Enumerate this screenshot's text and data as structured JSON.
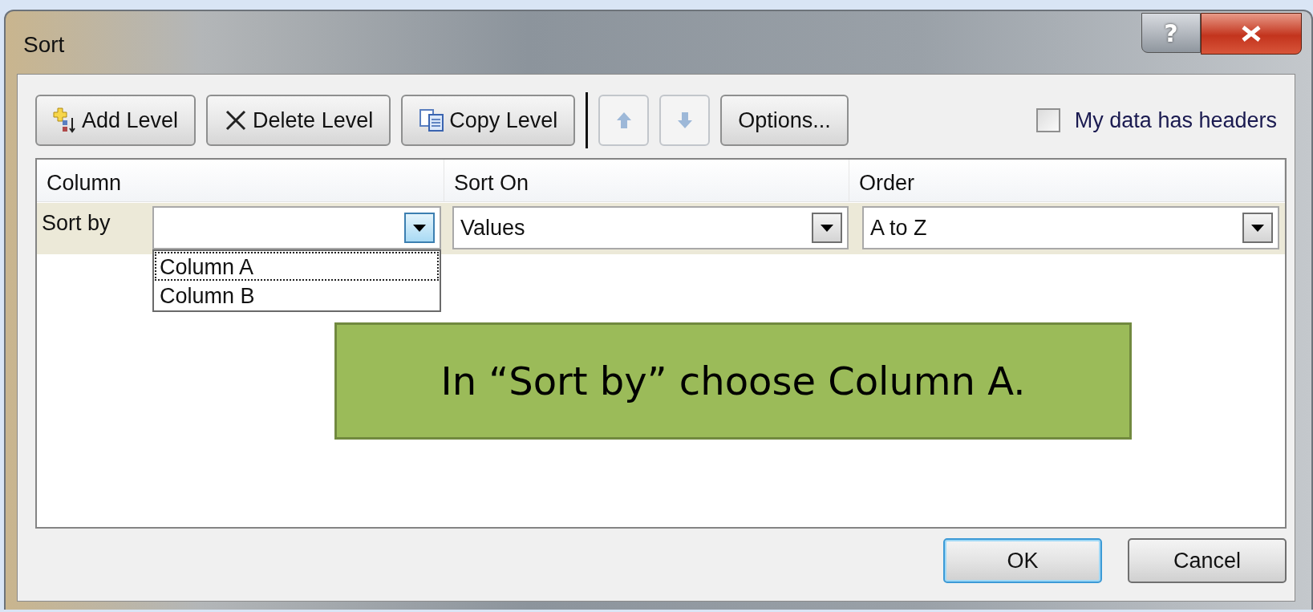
{
  "window": {
    "title": "Sort",
    "help_button": {
      "label": "?"
    }
  },
  "toolbar": {
    "buttons": [
      {
        "kind": "add",
        "label": "Add Level",
        "disabled": false
      },
      {
        "kind": "delete",
        "label": "Delete Level",
        "disabled": false
      },
      {
        "kind": "copy",
        "label": "Copy Level",
        "disabled": false
      },
      {
        "kind": "up",
        "disabled": true
      },
      {
        "kind": "down",
        "disabled": true
      },
      {
        "kind": "plain",
        "label": "Options...",
        "disabled": false
      }
    ],
    "checkbox": {
      "label": "My data has headers",
      "checked": false
    }
  },
  "grid": {
    "columns": [
      "Column",
      "Sort On",
      "Order"
    ],
    "row": {
      "label": "Sort by",
      "column": {
        "open": true,
        "options": [
          {
            "label": "Column A",
            "selected": true
          },
          {
            "label": "Column B",
            "selected": false
          }
        ]
      },
      "sort_on": {
        "value": "Values",
        "open": false
      },
      "order": {
        "value": "A to Z",
        "open": false
      }
    }
  },
  "callout": {
    "text": "In “Sort by” choose Column A."
  },
  "footer": {
    "buttons": [
      {
        "label": "OK",
        "default": true
      },
      {
        "label": "Cancel",
        "default": false
      }
    ]
  }
}
